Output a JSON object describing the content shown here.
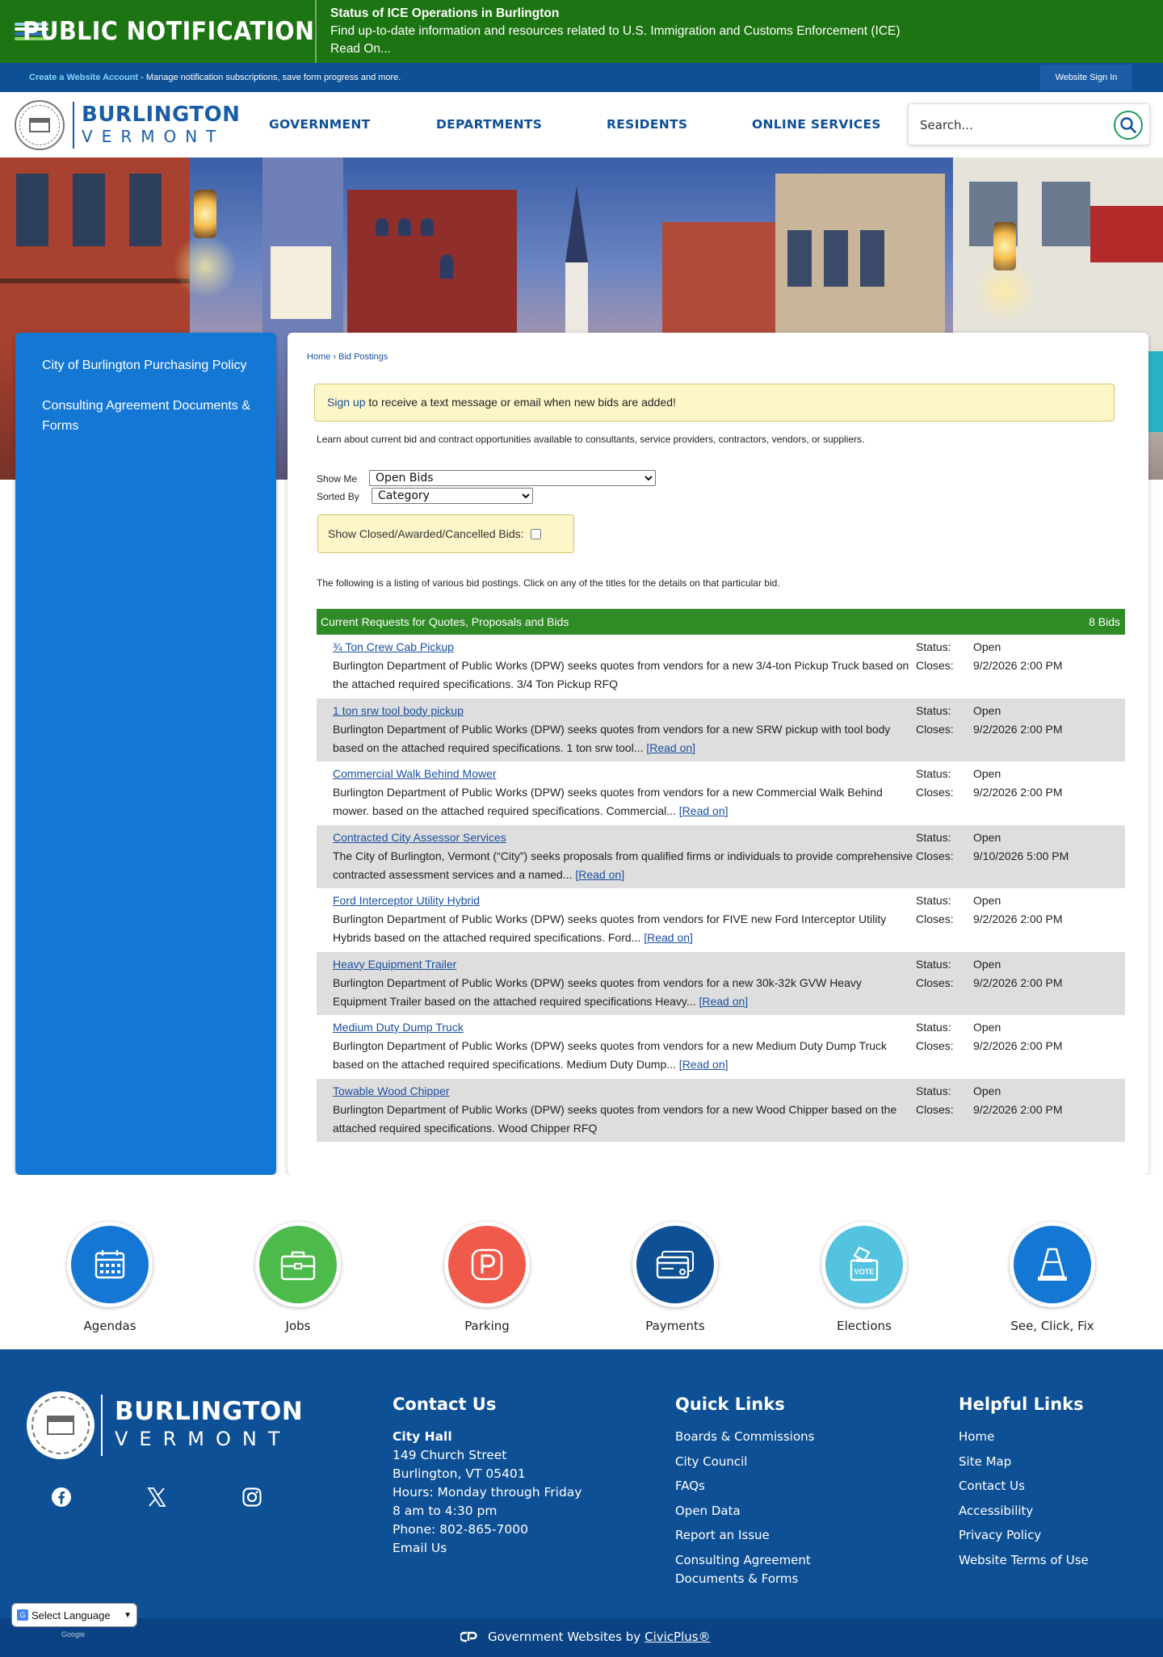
{
  "alert": {
    "title": "PUBLIC NOTIFICATION",
    "heading": "Status of ICE Operations in Burlington",
    "body": "Find up-to-date information and resources related to U.S. Immigration and Customs Enforcement (ICE)",
    "read_on": "Read On...",
    "colors": {
      "background": "#1c7412"
    }
  },
  "account_bar": {
    "create_link": "Create a Website Account",
    "text": " - Manage notification subscriptions, save form progress and more.",
    "sign_in": "Website Sign In"
  },
  "header": {
    "logo_name": "BURLINGTON",
    "logo_sub": "VERMONT",
    "nav": [
      "GOVERNMENT",
      "DEPARTMENTS",
      "RESIDENTS",
      "ONLINE SERVICES"
    ],
    "search_placeholder": "Search..."
  },
  "sidebar": {
    "items": [
      {
        "label": "City of Burlington Purchasing Policy"
      },
      {
        "label": "Consulting Agreement Documents & Forms"
      }
    ]
  },
  "main": {
    "breadcrumb": {
      "home": "Home",
      "sep": " › ",
      "current": "Bid Postings"
    },
    "signup_link": "Sign up",
    "signup_text": " to receive a text message or email when new bids are added!",
    "intro": "Learn about current bid and contract opportunities available to consultants, service providers, contractors, vendors, or suppliers.",
    "show_me_label": "Show Me",
    "show_me_value": "Open Bids",
    "sorted_by_label": "Sorted By",
    "sorted_by_value": "Category",
    "closed_label": "Show Closed/Awarded/Cancelled Bids:",
    "listing_note": "The following is a listing of various bid postings. Click on any of the titles for the details on that particular bid.",
    "table_title": "Current Requests for Quotes, Proposals and Bids",
    "table_count": "8 Bids",
    "status_label": "Status:",
    "closes_label": "Closes:",
    "read_on": "Read on",
    "bids": [
      {
        "title": "¾ Ton Crew Cab Pickup",
        "desc": "Burlington Department of Public Works (DPW) seeks quotes from vendors for a new 3/4-ton Pickup Truck based on the attached required specifications. 3/4 Ton Pickup RFQ",
        "status": "Open",
        "closes": "9/2/2026 2:00 PM",
        "has_read_on": false
      },
      {
        "title": "1 ton srw tool body pickup",
        "desc": "Burlington Department of Public Works (DPW) seeks quotes from vendors for a new SRW pickup with tool body based on the attached required specifications. 1 ton srw tool...",
        "status": "Open",
        "closes": "9/2/2026 2:00 PM",
        "has_read_on": true
      },
      {
        "title": "Commercial Walk Behind Mower",
        "desc": "Burlington Department of Public Works (DPW) seeks quotes from vendors for a new Commercial Walk Behind mower. based on the attached required specifications. Commercial...",
        "status": "Open",
        "closes": "9/2/2026 2:00 PM",
        "has_read_on": true
      },
      {
        "title": "Contracted City Assessor Services",
        "desc": "The City of Burlington, Vermont (“City”) seeks proposals from qualified firms or individuals to provide comprehensive contracted assessment services and a named...",
        "status": "Open",
        "closes": "9/10/2026 5:00 PM",
        "has_read_on": true
      },
      {
        "title": "Ford Interceptor Utility Hybrid",
        "desc": "Burlington Department of Public Works (DPW) seeks quotes from vendors for FIVE new Ford Interceptor Utility Hybrids based on the attached required specifications. Ford...",
        "status": "Open",
        "closes": "9/2/2026 2:00 PM",
        "has_read_on": true
      },
      {
        "title": "Heavy Equipment Trailer",
        "desc": "Burlington Department of Public Works (DPW) seeks quotes from vendors for a new 30k-32k GVW Heavy Equipment Trailer based on the attached required specifications Heavy...",
        "status": "Open",
        "closes": "9/2/2026 2:00 PM",
        "has_read_on": true
      },
      {
        "title": "Medium Duty Dump Truck",
        "desc": "Burlington Department of Public Works (DPW) seeks quotes from vendors for a new Medium Duty Dump Truck based on the attached required specifications. Medium Duty Dump...",
        "status": "Open",
        "closes": "9/2/2026 2:00 PM",
        "has_read_on": true
      },
      {
        "title": "Towable Wood Chipper",
        "desc": "Burlington Department of Public Works (DPW) seeks quotes from vendors for a new Wood Chipper based on the attached required specifications. Wood Chipper RFQ",
        "status": "Open",
        "closes": "9/2/2026 2:00 PM",
        "has_read_on": false
      }
    ]
  },
  "quick_links": [
    {
      "label": "Agendas",
      "icon": "calendar-icon",
      "color": "#1477d4"
    },
    {
      "label": "Jobs",
      "icon": "briefcase-icon",
      "color": "#4cbb4c"
    },
    {
      "label": "Parking",
      "icon": "parking-icon",
      "color": "#ef5a4b"
    },
    {
      "label": "Payments",
      "icon": "credit-card-icon",
      "color": "#0e5095"
    },
    {
      "label": "Elections",
      "icon": "ballot-box-icon",
      "color": "#53c3e0"
    },
    {
      "label": "See, Click, Fix",
      "icon": "traffic-cone-icon",
      "color": "#1477d4"
    }
  ],
  "footer": {
    "logo_name": "BURLINGTON",
    "logo_sub": "VERMONT",
    "social": [
      "facebook-icon",
      "x-icon",
      "instagram-icon"
    ],
    "contact": {
      "heading": "Contact Us",
      "name": "City Hall",
      "address1": "149 Church Street",
      "address2": "Burlington, VT 05401",
      "hours1": "Hours: Monday through Friday",
      "hours2": "8 am to 4:30 pm",
      "phone": "Phone: 802-865-7000",
      "email": "Email Us"
    },
    "quick": {
      "heading": "Quick Links",
      "links": [
        "Boards & Commissions",
        "City Council",
        "FAQs",
        "Open Data",
        "Report an Issue",
        "Consulting Agreement Documents & Forms"
      ]
    },
    "helpful": {
      "heading": "Helpful Links",
      "links": [
        "Home",
        "Site Map",
        "Contact Us",
        "Accessibility",
        "Privacy Policy",
        "Website Terms of Use"
      ]
    },
    "language": "Select Language",
    "google": "Google",
    "credit_prefix": "Government Websites by",
    "credit_link": "CivicPlus®"
  }
}
